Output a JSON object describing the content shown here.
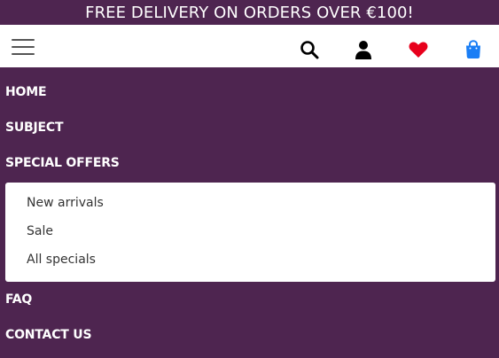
{
  "promo": {
    "text": "FREE DELIVERY ON ORDERS OVER €100!"
  },
  "header": {
    "menu_icon": "hamburger-menu-icon",
    "icons": [
      "search-icon",
      "account-icon",
      "heart-icon",
      "shopping-bag-icon"
    ]
  },
  "colors": {
    "brand": "#4e2550",
    "heart": "#e8001c",
    "bag": "#1a7ef5"
  },
  "nav": {
    "home": "HOME",
    "subject": "SUBJECT",
    "special_offers": "SPECIAL OFFERS",
    "faq": "FAQ",
    "contact": "CONTACT US"
  },
  "submenu": {
    "items": [
      "New arrivals",
      "Sale",
      "All specials"
    ]
  }
}
